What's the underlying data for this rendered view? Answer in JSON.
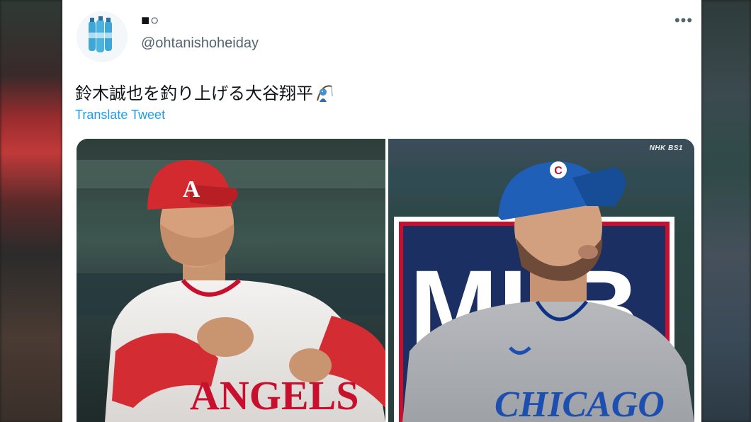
{
  "tweet": {
    "display_name": "■○",
    "handle": "@ohtanishoheiday",
    "text": "鈴木誠也を釣り上げる大谷翔平",
    "translate_label": "Translate Tweet",
    "more_icon": "more-horizontal-icon",
    "text_emoji": "fishing-person-emoji"
  },
  "media": {
    "watermark": "NHK BS1",
    "left_jersey_text": "ANGELS",
    "right_jersey_text": "CHICAGO",
    "left_cap_logo": "A",
    "right_cap_logo": "C",
    "wall_letters": "MLB"
  },
  "colors": {
    "link": "#1d9bf0",
    "text": "#0f1419",
    "secondary": "#536471",
    "angels_red": "#c8102e",
    "cubs_blue": "#0e3386"
  }
}
